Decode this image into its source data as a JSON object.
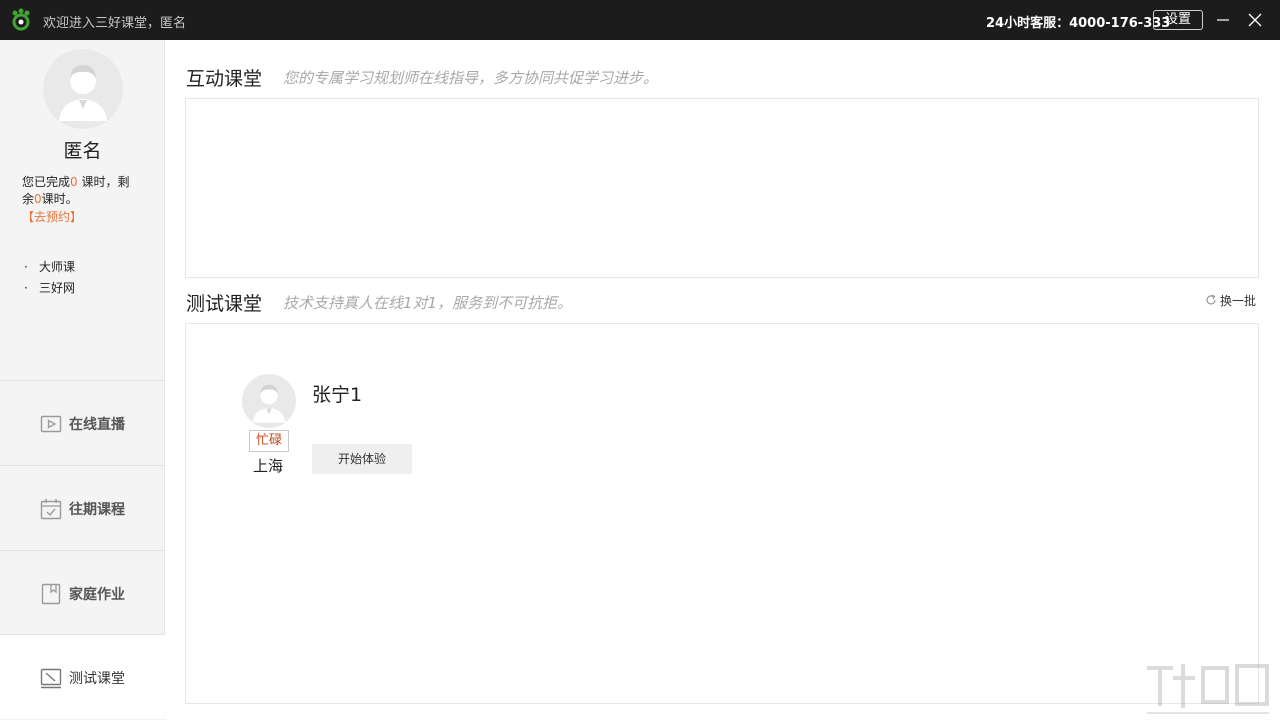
{
  "titlebar": {
    "welcome": "欢迎进入三好课堂，匿名",
    "hotline": "24小时客服：4000-176-333",
    "settings": "设置",
    "logo_icon": "paw-logo-icon",
    "brand_color": "#3fa535"
  },
  "sidebar": {
    "name": "匿名",
    "lesson_info": {
      "prefix": "您已完成",
      "done": "0",
      "middle": " 课时，剩余",
      "left": "0",
      "suffix": "课时。"
    },
    "book_link": "【去预约】",
    "links": [
      "大师课",
      "三好网"
    ],
    "nav": [
      {
        "label": "在线直播",
        "icon": "video-icon"
      },
      {
        "label": "往期课程",
        "icon": "calendar-icon"
      },
      {
        "label": "家庭作业",
        "icon": "homework-book-icon"
      },
      {
        "label": "测试课堂",
        "icon": "test-screen-icon",
        "active": true
      }
    ]
  },
  "sections": {
    "interactive": {
      "title": "互动课堂",
      "subtitle": "您的专属学习规划师在线指导，多方协同共促学习进步。"
    },
    "test": {
      "title": "测试课堂",
      "subtitle": "技术支持真人在线1对1，服务到不可抗拒。",
      "refresh": "换一批"
    }
  },
  "teacher": {
    "name": "张宁1",
    "status": "忙碌",
    "city": "上海",
    "start_button": "开始体验"
  },
  "colors": {
    "accent_orange": "#e8743a",
    "busy_red": "#c0481f",
    "titlebar_bg": "#1c1c1c"
  }
}
